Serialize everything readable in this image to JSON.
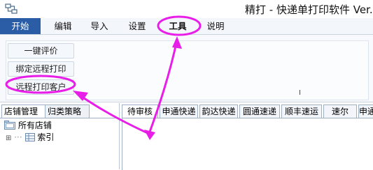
{
  "titlebar": {
    "title": "精打 - 快递单打印软件 Ver."
  },
  "ribbon_tabs": [
    {
      "label": "开始",
      "active": true
    },
    {
      "label": "编辑",
      "active": false
    },
    {
      "label": "导入",
      "active": false
    },
    {
      "label": "设置",
      "active": false
    },
    {
      "label": "工具",
      "active": false
    },
    {
      "label": "说明",
      "active": false
    }
  ],
  "ribbon_buttons": [
    {
      "label": "一键评价"
    },
    {
      "label": "绑定远程打印"
    },
    {
      "label": "远程打印客户"
    }
  ],
  "cursor_glyph": "I",
  "left_tabs": [
    {
      "label": "店铺管理",
      "active": true
    },
    {
      "label": "归类策略",
      "active": false
    }
  ],
  "tree": {
    "root": "所有店铺",
    "child": "索引",
    "expander": "⊞"
  },
  "order_tabs": [
    {
      "label": "待审核",
      "active": true
    },
    {
      "label": "申通快递",
      "active": false
    },
    {
      "label": "韵达快递",
      "active": false
    },
    {
      "label": "圆通速递",
      "active": false
    },
    {
      "label": "顺丰速运",
      "active": false
    },
    {
      "label": "速尔",
      "active": false
    },
    {
      "label": "申通",
      "active": false
    }
  ],
  "colors": {
    "accent_tab": "#2a5da6",
    "annotation": "#e81ee8"
  }
}
